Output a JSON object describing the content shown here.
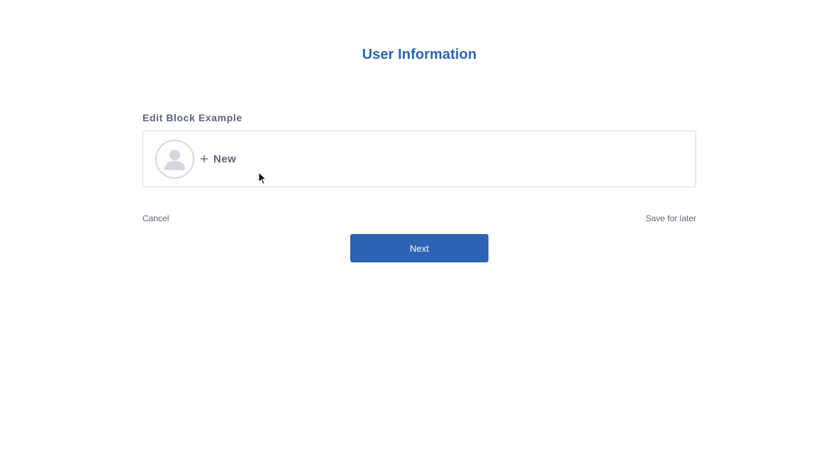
{
  "page": {
    "title": "User Information"
  },
  "edit_block": {
    "label": "Edit Block Example",
    "new_label": "New",
    "avatar_icon": "user-avatar-icon",
    "plus_icon": "plus-icon"
  },
  "footer": {
    "cancel_label": "Cancel",
    "save_label": "Save for later",
    "next_label": "Next"
  },
  "colors": {
    "accent": "#2c64b3",
    "text": "#5a6478",
    "border": "#d5d8de",
    "avatar": "#d3d7de"
  }
}
